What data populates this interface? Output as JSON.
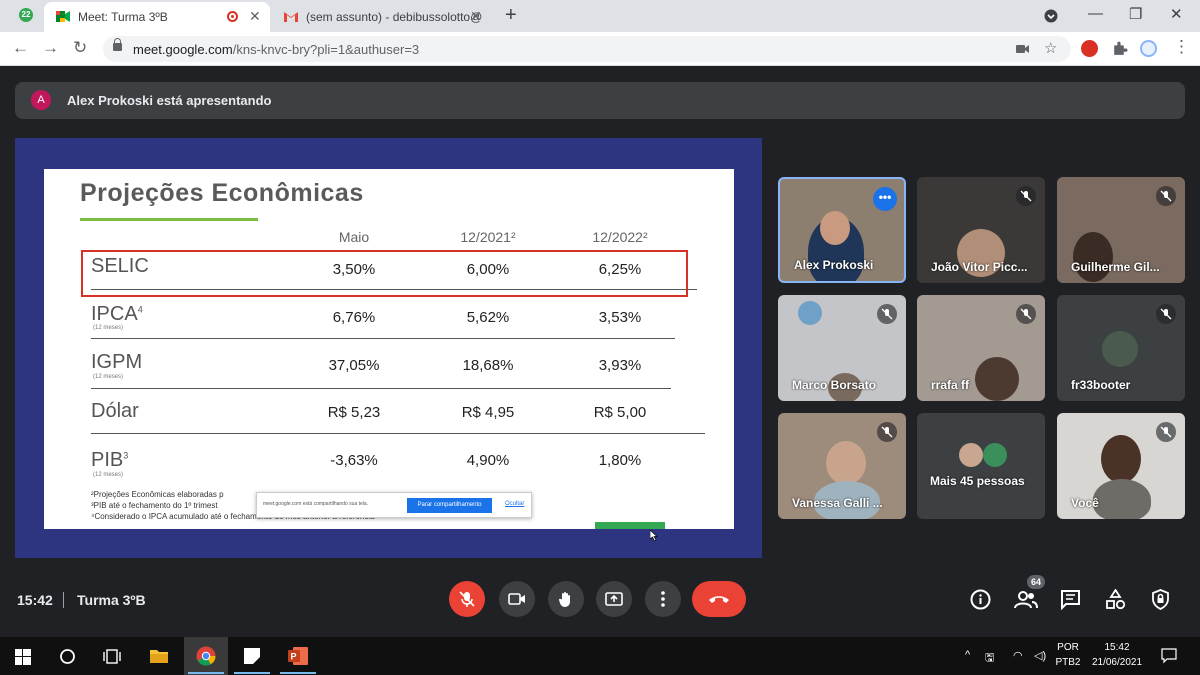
{
  "browser": {
    "tab_counter": "22",
    "tabs": [
      {
        "title": "Meet: Turma 3ºB",
        "active": true
      },
      {
        "title": "(sem assunto) - debibussolotto@",
        "active": false
      }
    ],
    "url_host": "meet.google.com",
    "url_path": "/kns-knvc-bry?pli=1&authuser=3"
  },
  "meet": {
    "presenter_avatar": "A",
    "presenter_banner": "Alex Prokoski está apresentando",
    "clock": "15:42",
    "meeting_name": "Turma 3ºB",
    "participants_count": "64",
    "participants": [
      {
        "name": "Alex Prokoski",
        "speaking": true
      },
      {
        "name": "João Vitor Picc...",
        "muted": true
      },
      {
        "name": "Guilherme Gil...",
        "muted": true
      },
      {
        "name": "Marco Borsato",
        "muted": true
      },
      {
        "name": "rrafa ff",
        "muted": true
      },
      {
        "name": "fr33booter",
        "muted": true
      },
      {
        "name": "Vanessa Galli ...",
        "muted": true
      },
      {
        "name": "Mais 45 pessoas"
      },
      {
        "name": "Você",
        "muted": true
      }
    ]
  },
  "slide": {
    "title": "Projeções Econômicas",
    "columns": [
      "Maio",
      "12/2021²",
      "12/2022²"
    ],
    "rows": [
      {
        "label": "SELIC",
        "sub": "",
        "values": [
          "3,50%",
          "6,00%",
          "6,25%"
        ]
      },
      {
        "label": "IPCA",
        "sup": "4",
        "sub": "(12 meses)",
        "values": [
          "6,76%",
          "5,62%",
          "3,53%"
        ]
      },
      {
        "label": "IGPM",
        "sup": "",
        "sub": "(12 meses)",
        "values": [
          "37,05%",
          "18,68%",
          "3,93%"
        ]
      },
      {
        "label": "Dólar",
        "sup": "",
        "sub": "",
        "values": [
          "R$ 5,23",
          "R$ 4,95",
          "R$ 5,00"
        ]
      },
      {
        "label": "PIB",
        "sup": "3",
        "sub": "(12 meses)",
        "values": [
          "-3,63%",
          "4,90%",
          "1,80%"
        ]
      }
    ],
    "footnotes": [
      "²Projeções Econômicas elaboradas p",
      "³PIB até o fechamento do 1º trimest",
      "⁴Considerado o IPCA acumulado até o fechamento do mês anterior à referência"
    ],
    "share_popup": {
      "message": "meet.google.com está compartilhando sua tela.",
      "stop_label": "Parar compartilhamento",
      "hide_label": "Ocultar"
    }
  },
  "taskbar": {
    "lang_top": "POR",
    "lang_bottom": "PTB2",
    "time": "15:42",
    "date": "21/06/2021"
  },
  "colors": {
    "meet_bg": "#202124",
    "slide_frame": "#2d3480",
    "highlight": "#d93025",
    "accent_green": "#7cbd41",
    "hangup_red": "#ea4335"
  }
}
